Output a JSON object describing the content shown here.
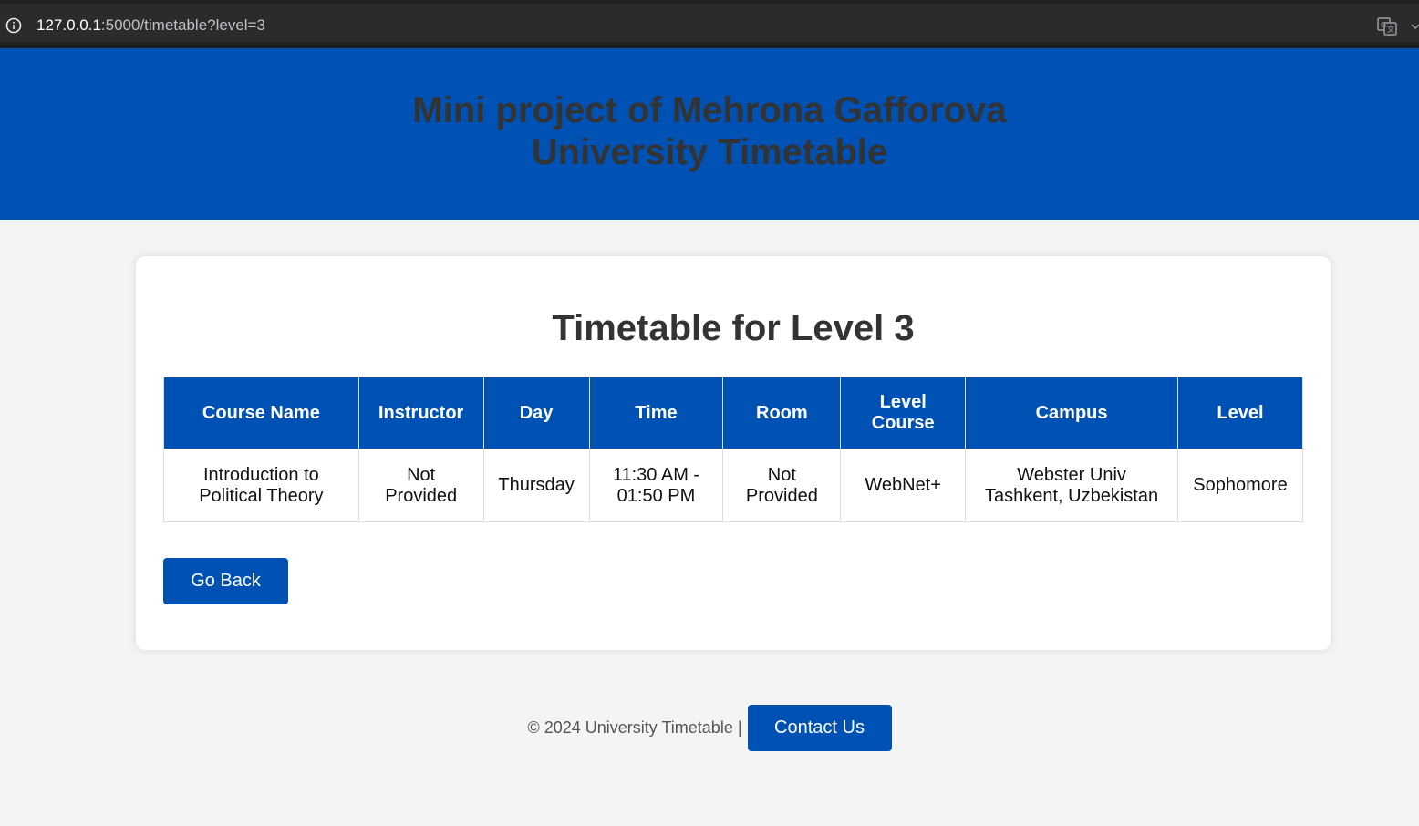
{
  "browser": {
    "url_host": "127.0.0.1",
    "url_rest": ":5000/timetable?level=3",
    "info_icon": "info-circle-icon",
    "translate_icon": "translate-icon"
  },
  "header": {
    "title_line1": "Mini project of Mehrona Gafforova",
    "title_line2": "University Timetable"
  },
  "main": {
    "heading": "Timetable for Level 3",
    "table": {
      "columns": [
        "Course Name",
        "Instructor",
        "Day",
        "Time",
        "Room",
        "Level Course",
        "Campus",
        "Level"
      ],
      "rows": [
        [
          "Introduction to Political Theory",
          "Not Provided",
          "Thursday",
          "11:30 AM - 01:50 PM",
          "Not Provided",
          "WebNet+",
          "Webster Univ Tashkent, Uzbekistan",
          "Sophomore"
        ]
      ]
    },
    "go_back_label": "Go Back"
  },
  "footer": {
    "text": "© 2024 University Timetable |",
    "contact_label": "Contact Us"
  },
  "colors": {
    "primary": "#0051b4",
    "page_bg": "#f4f4f4",
    "heading_text": "#333333"
  }
}
